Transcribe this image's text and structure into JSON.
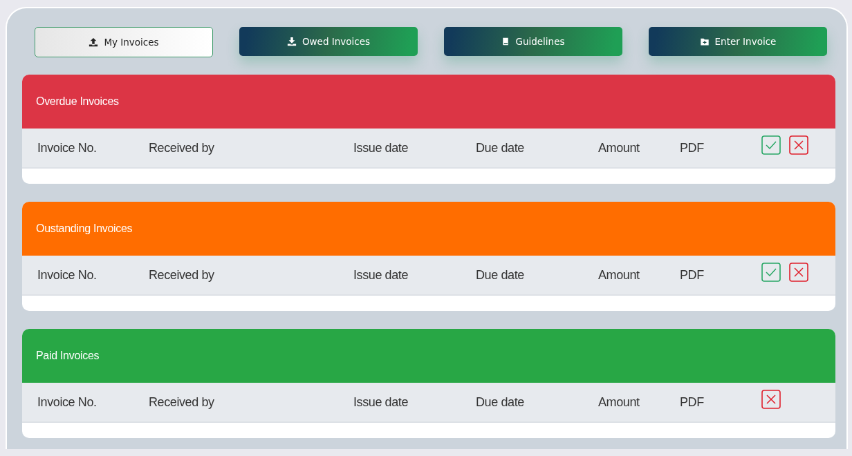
{
  "tabs": [
    {
      "label": "My Invoices",
      "selected": true
    },
    {
      "label": "Owed Invoices",
      "selected": false
    },
    {
      "label": "Guidelines",
      "selected": false
    },
    {
      "label": "Enter Invoice",
      "selected": false
    }
  ],
  "sections": [
    {
      "title": "Overdue Invoices",
      "color": "#dc3545",
      "columns": [
        "Invoice No.",
        "Received by",
        "Issue date",
        "Due date",
        "Amount",
        "PDF"
      ],
      "actions": [
        {
          "kind": "approve"
        },
        {
          "kind": "reject"
        }
      ]
    },
    {
      "title": "Oustanding Invoices",
      "color": "#ff6d00",
      "columns": [
        "Invoice No.",
        "Received by",
        "Issue date",
        "Due date",
        "Amount",
        "PDF"
      ],
      "actions": [
        {
          "kind": "approve"
        },
        {
          "kind": "reject"
        }
      ]
    },
    {
      "title": "Paid Invoices",
      "color": "#28a745",
      "columns": [
        "Invoice No.",
        "Received by",
        "Issue date",
        "Due date",
        "Amount",
        "PDF"
      ],
      "actions": [
        {
          "kind": "reject"
        }
      ]
    }
  ]
}
